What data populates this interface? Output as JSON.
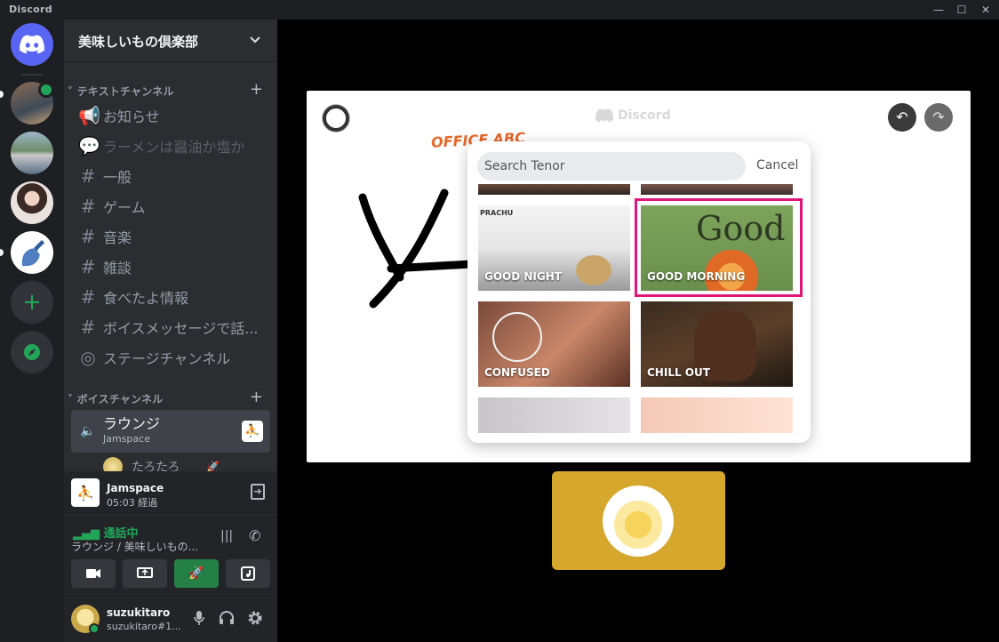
{
  "window": {
    "app_title": "Discord",
    "minimize": "—",
    "maximize": "☐",
    "close": "✕"
  },
  "guild": {
    "name": "美味しいもの倶楽部",
    "text_category": "テキストチャンネル",
    "voice_category": "ボイスチャンネル",
    "text_channels": [
      {
        "label": "お知らせ",
        "icon": "megaphone-icon"
      },
      {
        "label": "ラーメンは醤油か塩か",
        "icon": "thread-icon"
      },
      {
        "label": "一般",
        "icon": "hash-icon"
      },
      {
        "label": "ゲーム",
        "icon": "hash-icon"
      },
      {
        "label": "音楽",
        "icon": "hash-icon"
      },
      {
        "label": "雑談",
        "icon": "hash-icon"
      },
      {
        "label": "食べたよ情報",
        "icon": "hash-icon"
      },
      {
        "label": "ボイスメッセージで話...",
        "icon": "hash-icon"
      },
      {
        "label": "ステージチャンネル",
        "icon": "stage-icon"
      }
    ],
    "voice_channel": {
      "name": "ラウンジ",
      "activity": "Jamspace"
    },
    "voice_user": "たろたろ"
  },
  "activity_panel": {
    "name": "Jamspace",
    "elapsed": "05:03 経過"
  },
  "voice_status": {
    "status": "通話中",
    "location": "ラウンジ / 美味しいもの..."
  },
  "user": {
    "name": "suzukitaro",
    "tag": "suzukitaro#1..."
  },
  "canvas": {
    "watermark": "Discord",
    "sticker_text": "OFFICE ABC"
  },
  "tenor": {
    "search_placeholder": "Search Tenor",
    "cancel": "Cancel",
    "gifs": [
      {
        "label": "GOOD NIGHT",
        "top_text": "PRACHU"
      },
      {
        "label": "GOOD MORNING",
        "art_text": "Good"
      },
      {
        "label": "CONFUSED"
      },
      {
        "label": "CHILL OUT"
      }
    ]
  },
  "colors": {
    "blurple": "#5865f2",
    "green": "#23a559",
    "highlight": "#e0157a",
    "tile": "#d5a72c"
  }
}
